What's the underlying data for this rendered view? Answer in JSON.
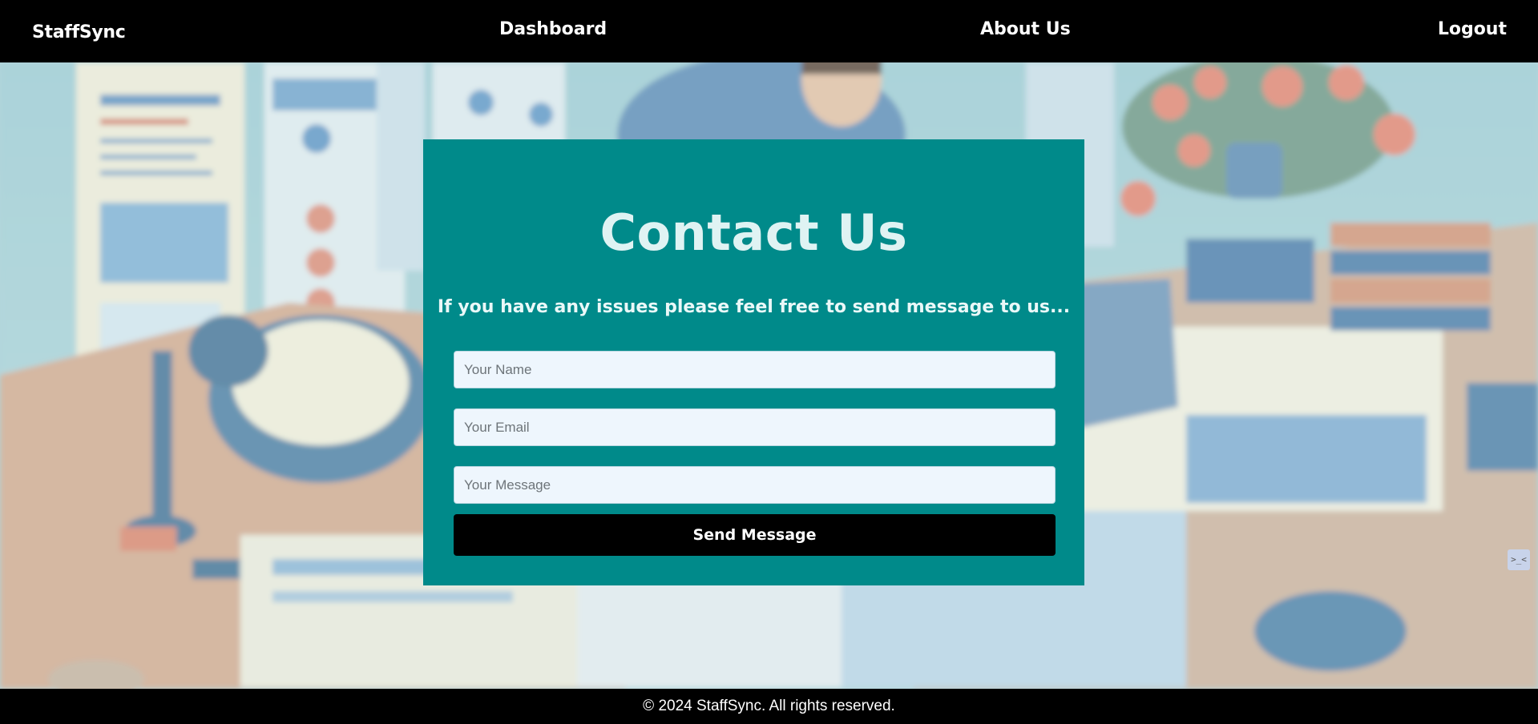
{
  "navbar": {
    "brand": "StaffSync",
    "links": {
      "dashboard": "Dashboard",
      "about": "About Us",
      "logout": "Logout"
    }
  },
  "contact": {
    "title": "Contact Us",
    "subtitle": "If you have any issues please feel free to send message to us...",
    "fields": {
      "name_placeholder": "Your Name",
      "email_placeholder": "Your Email",
      "message_placeholder": "Your Message"
    },
    "submit_label": "Send Message"
  },
  "footer": {
    "text": "© 2024 StaffSync. All rights reserved."
  },
  "widget": {
    "label": ">_<"
  },
  "colors": {
    "navbar": "#000000",
    "card": "#008a8a",
    "button": "#000000",
    "input": "#eef6fd"
  }
}
